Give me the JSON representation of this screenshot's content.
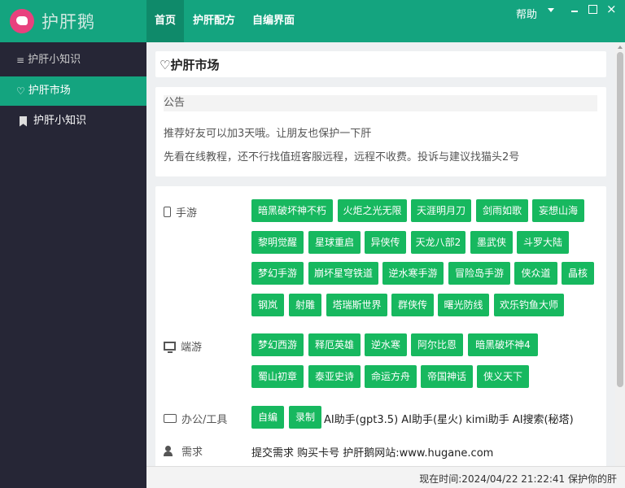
{
  "app": {
    "name": "护肝鹅"
  },
  "topnav": {
    "items": [
      "首页",
      "护肝配方",
      "自编界面"
    ],
    "help": "帮助"
  },
  "window": {
    "close": "×"
  },
  "sidebar": {
    "items": [
      {
        "label": "护肝小知识",
        "icon": "menu-icon"
      },
      {
        "label": "护肝市场",
        "icon": "heart-icon"
      },
      {
        "label": "护肝小知识",
        "icon": "bookmark-icon"
      }
    ]
  },
  "market": {
    "title": "护肝市场"
  },
  "notice": {
    "header": "公告",
    "lines": [
      "推荐好友可以加3天哦。让朋友也保护一下肝",
      "先看在线教程，还不行找值班客服远程，远程不收费。投诉与建议找猫头2号"
    ]
  },
  "categories": {
    "mobile": {
      "label": "手游",
      "items": [
        "暗黑破坏神不朽",
        "火炬之光无限",
        "天涯明月刀",
        "剑雨如歌",
        "妄想山海",
        "黎明觉醒",
        "星球重启",
        "异侠传",
        "天龙八部2",
        "墨武侠",
        "斗罗大陆",
        "梦幻手游",
        "崩坏星穹铁道",
        "逆水寒手游",
        "冒险岛手游",
        "侠众道",
        "晶核",
        "钢岚",
        "射雕",
        "塔瑞斯世界",
        "群侠传",
        "曙光防线",
        "欢乐钓鱼大师"
      ]
    },
    "pc": {
      "label": "端游",
      "items": [
        "梦幻西游",
        "释厄英雄",
        "逆水寒",
        "阿尔比恩",
        "暗黑破坏神4",
        "蜀山初章",
        "泰亚史诗",
        "命运方舟",
        "帝国神话",
        "侠义天下"
      ]
    },
    "tools": {
      "label": "办公/工具",
      "items": [
        "自编",
        "录制"
      ],
      "links": "AI助手(gpt3.5) AI助手(星火) kimi助手 AI搜索(秘塔)"
    },
    "request": {
      "label": "需求",
      "links": "提交需求 购买卡号 护肝鹅网站:www.hugane.com"
    }
  },
  "footer": {
    "time_label": "现在时间:2024/04/22 21:22:41 保护你的肝"
  },
  "colors": {
    "header": "#14a47f",
    "sidebar": "#262636",
    "button": "#17b85f",
    "logo": "#e8417e"
  }
}
